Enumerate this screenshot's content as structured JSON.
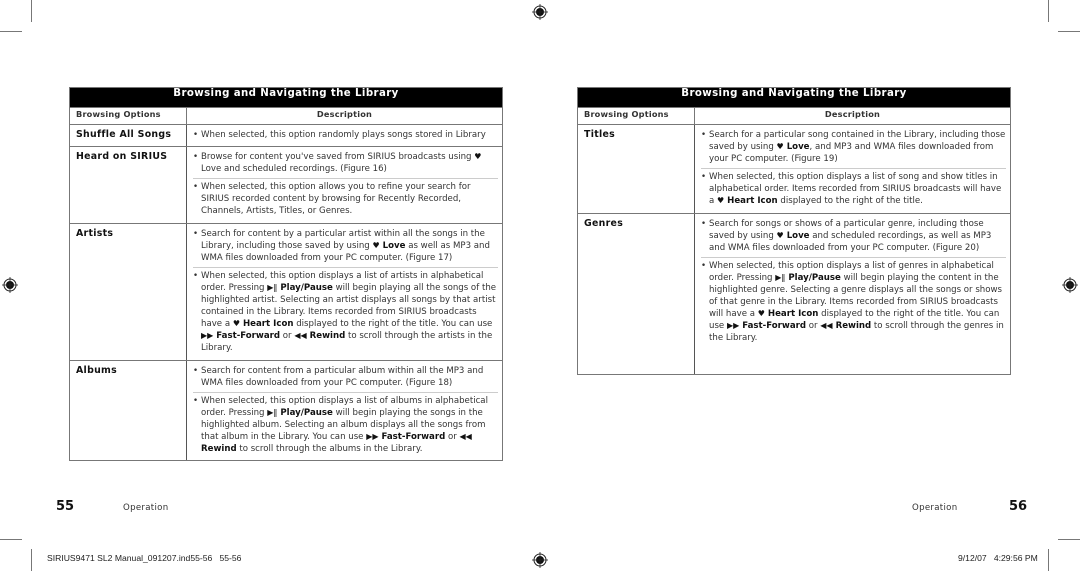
{
  "left_page": {
    "table_title": "Browsing and Navigating the Library",
    "col_option": "Browsing Options",
    "col_description": "Description",
    "rows": [
      {
        "option": "Shuffle All Songs",
        "bullets": [
          [
            {
              "t": "When selected, this option randomly plays songs stored in Library"
            }
          ]
        ]
      },
      {
        "option": "Heard on SIRIUS",
        "bullets": [
          [
            {
              "t": "Browse for content you've saved from SIRIUS broadcasts using "
            },
            {
              "icon": "heart"
            },
            {
              "t": " Love and scheduled recordings. (Figure 16)"
            }
          ],
          [
            {
              "t": "When selected, this option allows you to refine your search for SIRIUS recorded content by browsing for Recently Recorded, Channels, Artists, Titles, or Genres."
            }
          ]
        ]
      },
      {
        "option": "Artists",
        "bullets": [
          [
            {
              "t": "Search for content by a particular artist within all the songs in the Library, including those saved by using "
            },
            {
              "icon": "heart"
            },
            {
              "b": " Love"
            },
            {
              "t": " as well as MP3 and WMA files downloaded from your PC computer. (Figure 17)"
            }
          ],
          [
            {
              "t": "When selected, this option displays a list of artists in alphabetical order. Pressing "
            },
            {
              "icon": "playpause"
            },
            {
              "b": " Play/Pause"
            },
            {
              "t": " will begin playing all the songs of the highlighted artist. Selecting an artist displays all songs by that artist contained in the Library. Items recorded from SIRIUS broadcasts have a "
            },
            {
              "icon": "heart"
            },
            {
              "b": " Heart Icon"
            },
            {
              "t": " displayed to the right of the title. You can use "
            },
            {
              "icon": "ff"
            },
            {
              "b": " Fast-Forward"
            },
            {
              "t": " or "
            },
            {
              "icon": "rw"
            },
            {
              "b": " Rewind"
            },
            {
              "t": " to scroll through the artists in the Library."
            }
          ]
        ]
      },
      {
        "option": "Albums",
        "bullets": [
          [
            {
              "t": "Search for content from a particular album within all the MP3 and WMA files downloaded from your PC computer. (Figure 18)"
            }
          ],
          [
            {
              "t": "When selected, this option displays a list of albums in alphabetical order. Pressing "
            },
            {
              "icon": "playpause"
            },
            {
              "b": " Play/Pause"
            },
            {
              "t": " will begin playing the songs in the highlighted album. Selecting an album displays all the songs from that album in the Library. You can use "
            },
            {
              "icon": "ff"
            },
            {
              "b": " Fast-Forward"
            },
            {
              "t": " or "
            },
            {
              "icon": "rw"
            },
            {
              "b": " Rewind"
            },
            {
              "t": " to scroll through the albums in the Library."
            }
          ]
        ]
      }
    ],
    "page_number": "55",
    "section": "Operation"
  },
  "right_page": {
    "table_title": "Browsing and Navigating the Library",
    "col_option": "Browsing Options",
    "col_description": "Description",
    "rows": [
      {
        "option": "Titles",
        "bullets": [
          [
            {
              "t": "Search for a particular song contained in the Library, including those saved by using "
            },
            {
              "icon": "heart"
            },
            {
              "b": " Love"
            },
            {
              "t": ", and MP3 and WMA files downloaded from your PC computer. (Figure 19)"
            }
          ],
          [
            {
              "t": "When selected, this option displays a list of song and show titles in alphabetical order. Items recorded from SIRIUS broadcasts will have a "
            },
            {
              "icon": "heart"
            },
            {
              "b": " Heart Icon"
            },
            {
              "t": " displayed to the right of the title."
            }
          ]
        ]
      },
      {
        "option": "Genres",
        "bullets": [
          [
            {
              "t": "Search for songs or shows of a particular genre, including those saved by using "
            },
            {
              "icon": "heart"
            },
            {
              "b": " Love"
            },
            {
              "t": " and scheduled recordings, as well as MP3 and WMA files downloaded from your PC computer. (Figure 20)"
            }
          ],
          [
            {
              "t": "When selected, this option displays a list of genres in alphabetical order. Pressing "
            },
            {
              "icon": "playpause"
            },
            {
              "b": " Play/Pause"
            },
            {
              "t": " will begin playing the content in the highlighted genre. Selecting a genre displays all the songs or shows of that genre in the Library. Items recorded from SIRIUS broadcasts will have a "
            },
            {
              "icon": "heart"
            },
            {
              "b": " Heart Icon"
            },
            {
              "t": " displayed to the right of the title. You can use "
            },
            {
              "icon": "ff"
            },
            {
              "b": " Fast-Forward"
            },
            {
              "t": " or "
            },
            {
              "icon": "rw"
            },
            {
              "b": " Rewind"
            },
            {
              "t": " to scroll through the genres in the Library."
            }
          ]
        ]
      }
    ],
    "page_number": "56",
    "section": "Operation"
  },
  "icons": {
    "heart": "♥",
    "playpause": "▶‖",
    "ff": "▶▶",
    "rw": "◀◀",
    "bullet": "•"
  },
  "slug": {
    "file": "SIRIUS9471 SL2 Manual_091207.ind55-56   55-56",
    "timestamp": "9/12/07   4:29:56 PM"
  }
}
